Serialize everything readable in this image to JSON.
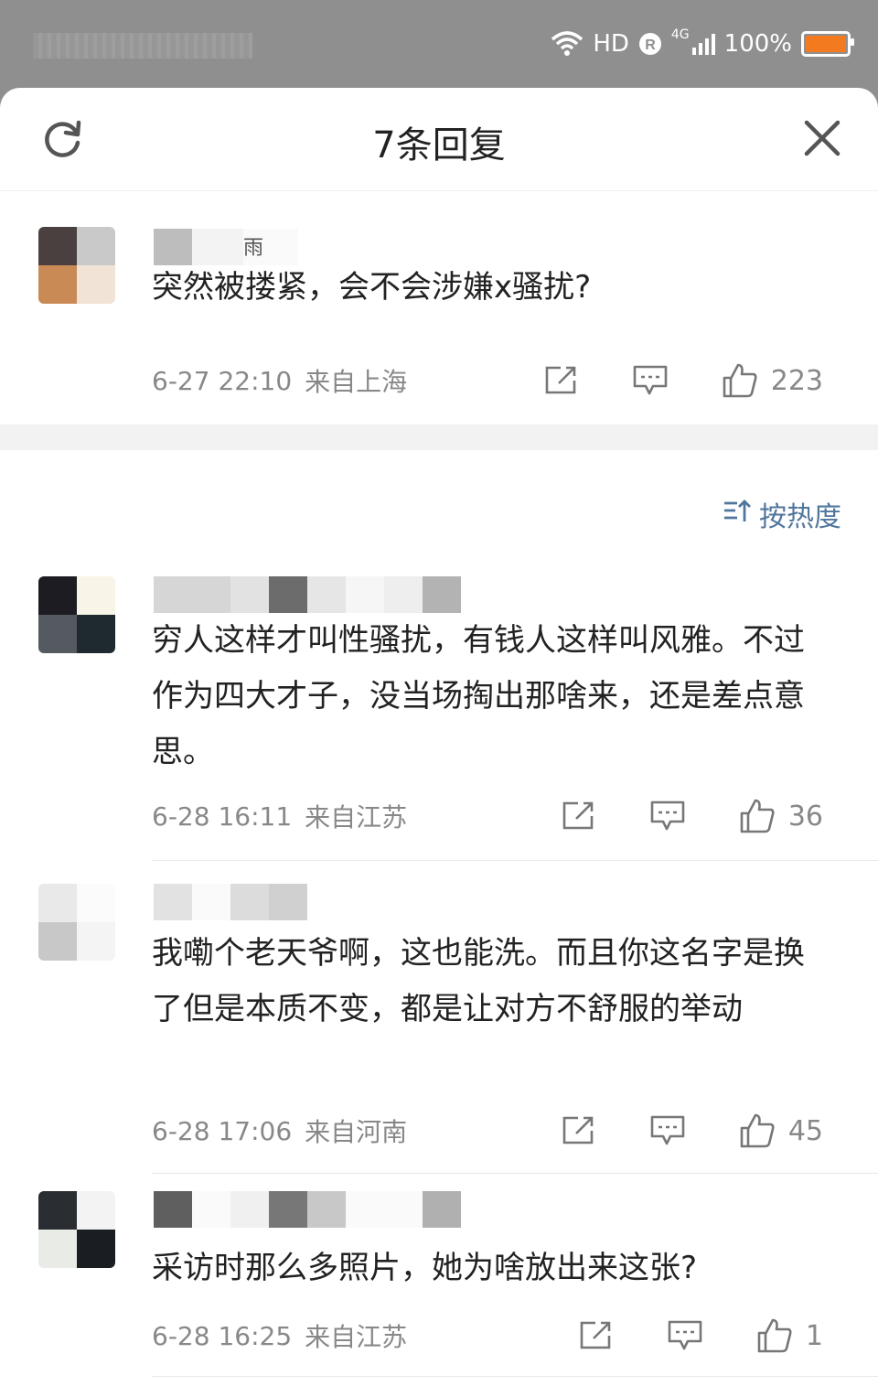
{
  "statusbar": {
    "network": "HD",
    "signal": "4G",
    "battery": "100%"
  },
  "header": {
    "title": "7条回复"
  },
  "root_comment": {
    "name_hint": "雨",
    "text": "突然被搂紧，会不会涉嫌x骚扰?",
    "time": "6-27 22:10",
    "location": "来自上海",
    "likes": "223"
  },
  "sort": {
    "label": "按热度"
  },
  "replies": [
    {
      "text": "穷人这样才叫性骚扰，有钱人这样叫风雅。不过作为四大才子，没当场掏出那啥来，还是差点意思。",
      "time": "6-28 16:11",
      "location": "来自江苏",
      "likes": "36"
    },
    {
      "text": "我嘞个老天爷啊，这也能洗。而且你这名字是换了但是本质不变，都是让对方不舒服的举动",
      "time": "6-28 17:06",
      "location": "来自河南",
      "likes": "45"
    },
    {
      "text": "采访时那么多照片，她为啥放出来这张?",
      "time": "6-28 16:25",
      "location": "来自江苏",
      "likes": "1"
    }
  ],
  "icons": {
    "refresh": "refresh-icon",
    "close": "close-icon",
    "share": "share-icon",
    "comment": "comment-icon",
    "like": "thumbs-up-icon",
    "sort": "sort-icon"
  },
  "colors": {
    "accent": "#51769e",
    "battery": "#f47a1f",
    "meta": "#888888"
  }
}
